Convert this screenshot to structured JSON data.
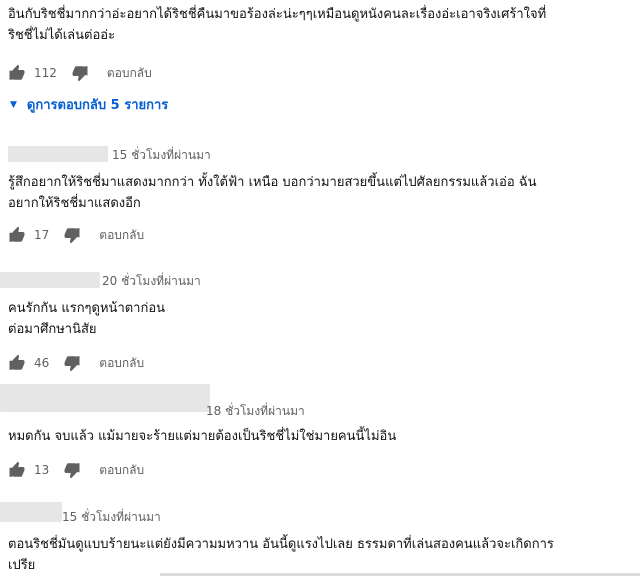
{
  "top_comment": {
    "text_line1": "อินกับริชชี่มากกว่าอ่ะอยากได้ริชชี่คืนมาขอร้องล่ะน่ะๆๆเหมือนดูหนังคนละเรื่องอ่ะเอาจริงเศร้าใจที่",
    "text_line2": "ริชชี่ไม่ได้เล่นต่ออ่ะ",
    "likes": "112",
    "reply_label": "ตอบกลับ"
  },
  "view_replies": {
    "label": "ดูการตอบกลับ 5 รายการ",
    "icon": "caret-down-icon"
  },
  "replies": [
    {
      "time": "15 ชั่วโมงที่ผ่านมา",
      "text_line1": "รู้สึกอยากให้ริชชี่มาแสดงมากกว่า ทั้งใต้ฟ้า เหนือ บอกว่ามายสวยขึ้นแต่ไปศัลยกรรมแล้วเอ่อ ฉัน",
      "text_line2": "อยากให้ริชชี่มาแสดงอีก",
      "likes": "17",
      "reply_label": "ตอบกลับ"
    },
    {
      "time": "20 ชั่วโมงที่ผ่านมา",
      "text_line1": "คนรักกัน แรกๆดูหน้าตาก่อน",
      "text_line2": "ต่อมาศึกษานิสัย",
      "likes": "46",
      "reply_label": "ตอบกลับ"
    },
    {
      "time": "18 ชั่วโมงที่ผ่านมา",
      "text_line1": "หมดกัน จบแล้ว แม้มายจะร้ายแต่มายต้องเป็นริชชี่ไม่ใช่มายคนนี้ไม่อิน",
      "likes": "13",
      "reply_label": "ตอบกลับ"
    },
    {
      "time": "15 ชั่วโมงที่ผ่านมา",
      "text_line1": "ตอนริชชี่มันดูแบบร้ายนะแต่ยังมีความมหวาน อันนี้ดูแรงไปเลย ธรรมดาที่เล่นสองคนแล้วจะเกิดการ",
      "text_line2": "เปรีย"
    }
  ],
  "icons": {
    "like": "thumbs-up-icon",
    "dislike": "thumbs-down-icon"
  },
  "colors": {
    "link": "#065fd4",
    "meta": "#606060",
    "icon": "#606060"
  }
}
